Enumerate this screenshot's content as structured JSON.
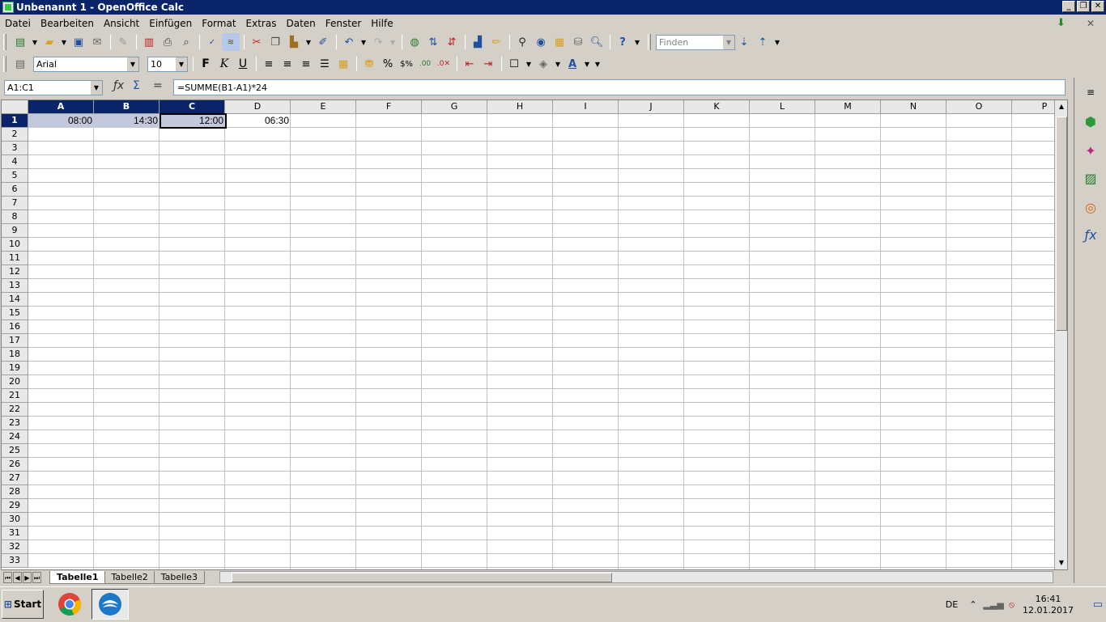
{
  "window": {
    "title": "Unbenannt 1 - OpenOffice Calc",
    "controls": [
      "_",
      "❐",
      "✕"
    ]
  },
  "menu": {
    "items": [
      "Datei",
      "Bearbeiten",
      "Ansicht",
      "Einfügen",
      "Format",
      "Extras",
      "Daten",
      "Fenster",
      "Hilfe"
    ],
    "close_doc": "✕"
  },
  "toolbar": {
    "find_placeholder": "Finden"
  },
  "formatting": {
    "font_name": "Arial",
    "font_size": "10",
    "bold": "F",
    "italic": "K",
    "underline": "U"
  },
  "formula_bar": {
    "name_box": "A1:C1",
    "formula": "=SUMME(B1-A1)*24",
    "sum_symbol": "Σ",
    "equals_symbol": "="
  },
  "sheet": {
    "columns": [
      "A",
      "B",
      "C",
      "D",
      "E",
      "F",
      "G",
      "H",
      "I",
      "J",
      "K",
      "L",
      "M",
      "N",
      "O",
      "P"
    ],
    "selected_columns": [
      "A",
      "B",
      "C"
    ],
    "rows": [
      "1",
      "2",
      "3",
      "4",
      "5",
      "6",
      "7",
      "8",
      "9",
      "10",
      "11",
      "12",
      "13",
      "14",
      "15",
      "16",
      "17",
      "18",
      "19",
      "20",
      "21",
      "22",
      "23",
      "24",
      "25",
      "26",
      "27",
      "28",
      "29",
      "30",
      "31",
      "32",
      "33"
    ],
    "cells": {
      "A1": "08:00",
      "B1": "14:30",
      "C1": "12:00",
      "D1": "06:30"
    },
    "tabs": [
      "Tabelle1",
      "Tabelle2",
      "Tabelle3"
    ],
    "active_tab": "Tabelle1"
  },
  "taskbar": {
    "start_label": "Start",
    "language": "DE",
    "time": "16:41",
    "date": "12.01.2017"
  },
  "colors": {
    "title_bg": "#0a246a",
    "selection": "#c4c8dc",
    "header_selected": "#0a246a"
  }
}
